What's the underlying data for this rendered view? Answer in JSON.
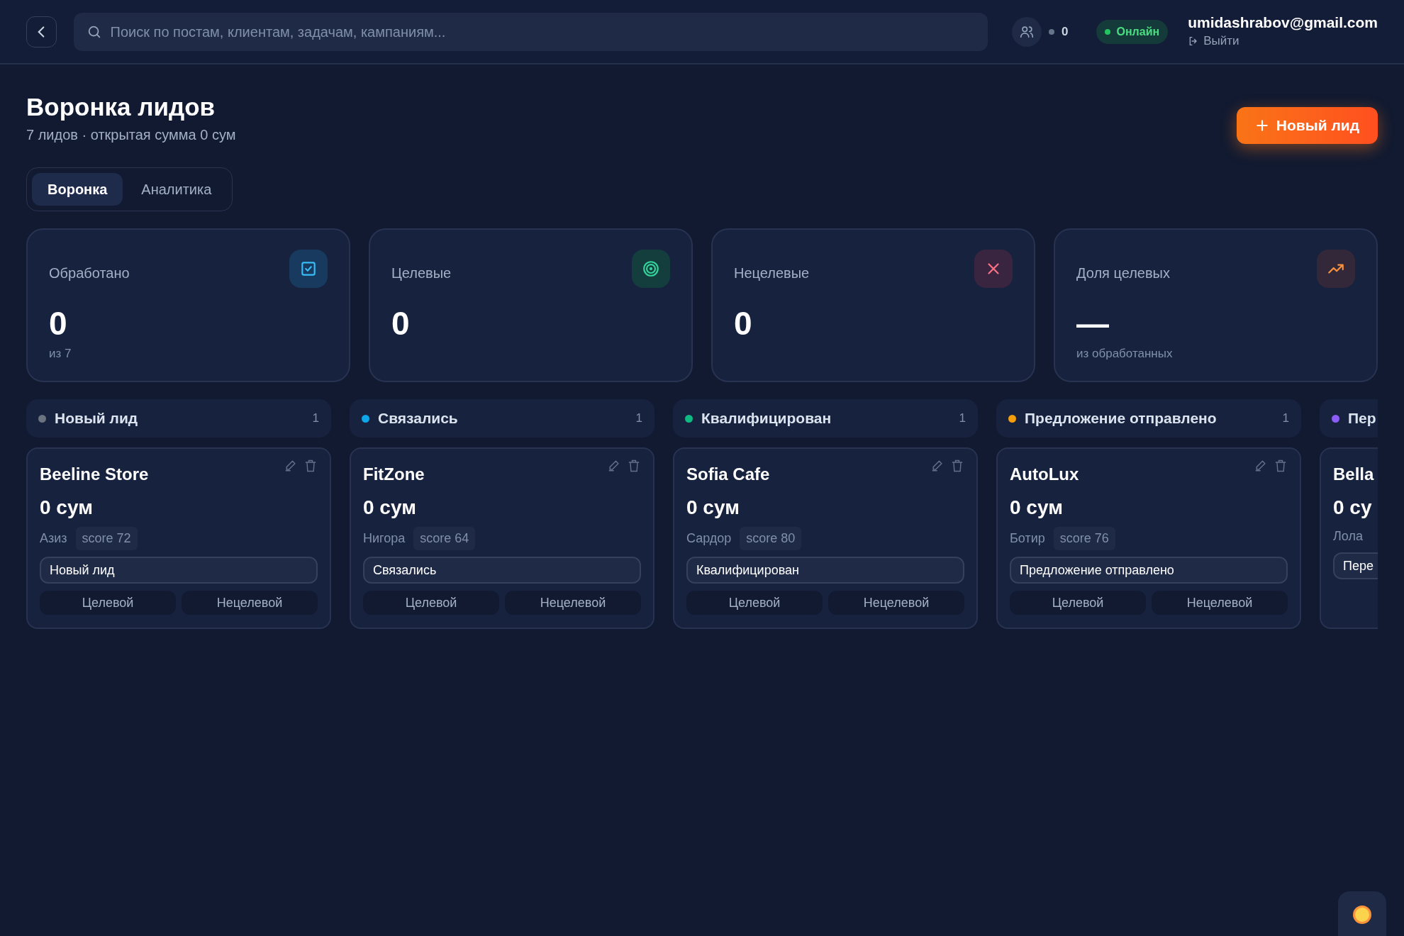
{
  "header": {
    "search": {
      "placeholder": "Поиск по постам, клиентам, задачам, кампаниям..."
    },
    "users_count": "0",
    "status": "Онлайн",
    "email": "umidashrabov@gmail.com",
    "logout": "Выйти"
  },
  "page": {
    "title": "Воронка лидов",
    "subtitle": "7 лидов · открытая сумма 0 сум",
    "new_button": "Новый лид"
  },
  "tabs": [
    {
      "label": "Воронка",
      "selected": true
    },
    {
      "label": "Аналитика",
      "selected": false
    }
  ],
  "stats": [
    {
      "label": "Обработано",
      "value": "0",
      "note": "из 7",
      "kind": "check"
    },
    {
      "label": "Целевые",
      "value": "0",
      "kind": "target"
    },
    {
      "label": "Нецелевые",
      "value": "0",
      "kind": "cross"
    },
    {
      "label": "Доля целевых",
      "value": "—",
      "note": "из обработанных",
      "kind": "trend"
    }
  ],
  "columns": [
    {
      "title": "Новый лид",
      "color": "#6b7280",
      "count": "1",
      "leads": [
        {
          "name": "Beeline Store",
          "amount": "0 сум",
          "contact": "Азиз",
          "score": "score 72",
          "stage": "Новый лид",
          "buttons": [
            "Целевой",
            "Нецелевой"
          ]
        }
      ]
    },
    {
      "title": "Связались",
      "color": "#0ea5e9",
      "count": "1",
      "leads": [
        {
          "name": "FitZone",
          "amount": "0 сум",
          "contact": "Нигора",
          "score": "score 64",
          "stage": "Связались",
          "buttons": [
            "Целевой",
            "Нецелевой"
          ]
        }
      ]
    },
    {
      "title": "Квалифицирован",
      "color": "#10b981",
      "count": "1",
      "leads": [
        {
          "name": "Sofia Cafe",
          "amount": "0 сум",
          "contact": "Сардор",
          "score": "score 80",
          "stage": "Квалифицирован",
          "buttons": [
            "Целевой",
            "Нецелевой"
          ]
        }
      ]
    },
    {
      "title": "Предложение отправлено",
      "color": "#f59e0b",
      "count": "1",
      "leads": [
        {
          "name": "AutoLux",
          "amount": "0 сум",
          "contact": "Ботир",
          "score": "score 76",
          "stage": "Предложение отправлено",
          "buttons": [
            "Целевой",
            "Нецелевой"
          ]
        }
      ]
    },
    {
      "title": "Пер",
      "color": "#8b5cf6",
      "leads": [
        {
          "name": "Bella",
          "amount": "0 су",
          "contact": "Лола",
          "stage": "Пере"
        }
      ]
    }
  ]
}
